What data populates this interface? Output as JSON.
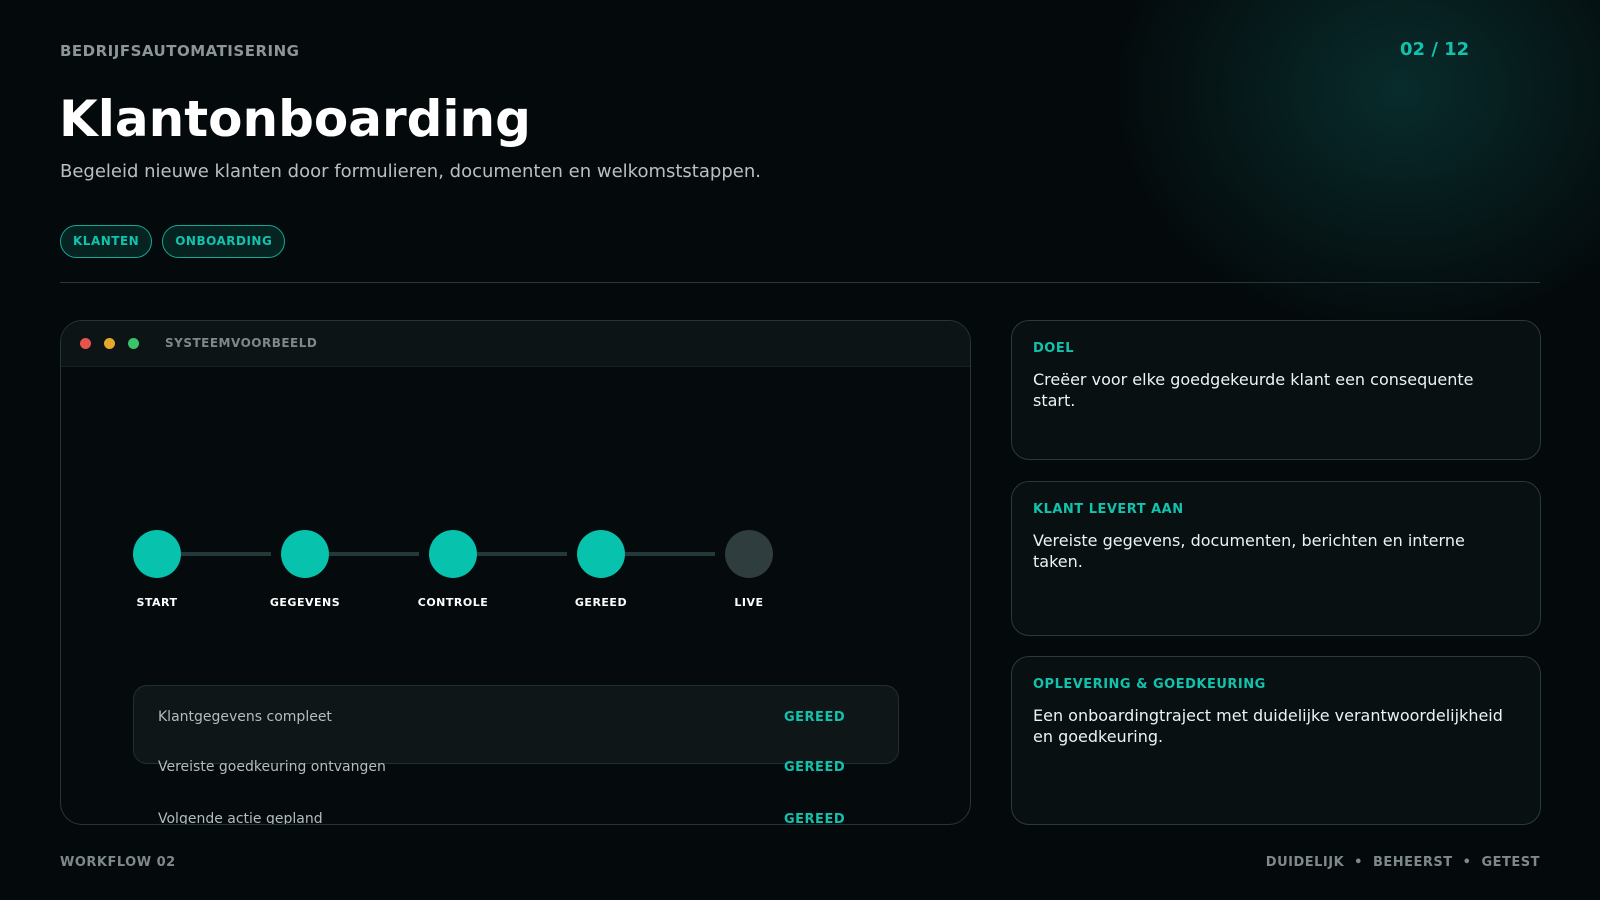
{
  "header": {
    "eyebrow": "BEDRIJFSAUTOMATISERING",
    "page_indicator": "02 / 12",
    "title": "Klantonboarding",
    "subtitle": "Begeleid nieuwe klanten door formulieren, documenten en welkomststappen.",
    "tags": [
      "KLANTEN",
      "ONBOARDING"
    ]
  },
  "preview": {
    "window_title": "SYSTEEMVOORBEELD",
    "steps": [
      {
        "label": "START",
        "state": "done"
      },
      {
        "label": "GEGEVENS",
        "state": "done"
      },
      {
        "label": "CONTROLE",
        "state": "done"
      },
      {
        "label": "GEREED",
        "state": "done"
      },
      {
        "label": "LIVE",
        "state": "pending"
      }
    ],
    "checklist": [
      {
        "text": "Klantgegevens compleet",
        "status": "GEREED"
      },
      {
        "text": "Vereiste goedkeuring ontvangen",
        "status": "GEREED"
      },
      {
        "text": "Volgende actie gepland",
        "status": "GEREED"
      }
    ]
  },
  "cards": [
    {
      "title": "DOEL",
      "body": "Creëer voor elke goedgekeurde klant een consequente start."
    },
    {
      "title": "KLANT LEVERT AAN",
      "body": "Vereiste gegevens, documenten, berichten en interne taken."
    },
    {
      "title": "OPLEVERING & GOEDKEURING",
      "body": "Een onboardingtraject met duidelijke verantwoordelijkheid en goedkeuring."
    }
  ],
  "footer": {
    "left": "WORKFLOW 02",
    "right": [
      "DUIDELIJK",
      "BEHEERST",
      "GETEST"
    ],
    "separator": "•"
  },
  "colors": {
    "accent": "#13c2ad",
    "step_done": "#07c3ae",
    "step_pending": "#2f3d3e",
    "background": "#04090b"
  }
}
